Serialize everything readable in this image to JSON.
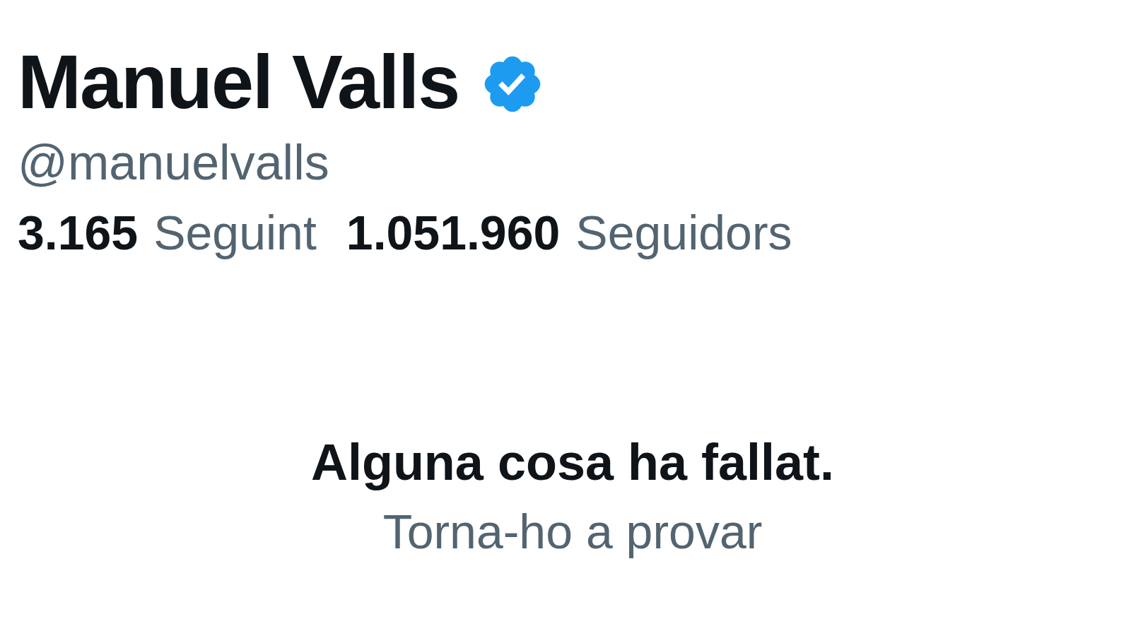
{
  "profile": {
    "name": "Manuel Valls",
    "verified": true,
    "handle": "@manuelvalls",
    "stats": [
      {
        "count": "3.165",
        "label": "Seguint"
      },
      {
        "count": "1.051.960",
        "label": "Seguidors"
      }
    ]
  },
  "error": {
    "title": "Alguna cosa ha fallat.",
    "retry": "Torna-ho a provar"
  }
}
